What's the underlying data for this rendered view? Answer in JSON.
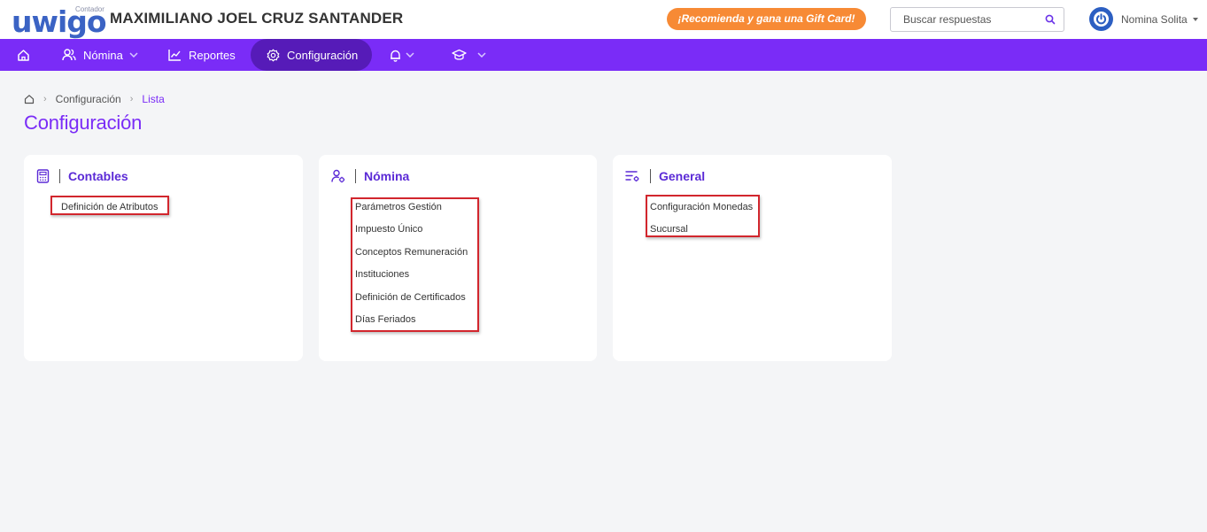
{
  "header": {
    "logo_text": "uwigo",
    "logo_sub": "Contador",
    "company_name": "MAXIMILIANO JOEL CRUZ SANTANDER",
    "promo_label": "¡Recomienda y gana una Gift Card!",
    "search_placeholder": "Buscar respuestas",
    "user_name": "Nomina Solita"
  },
  "nav": {
    "items": [
      {
        "label": "",
        "icon": "home-icon"
      },
      {
        "label": "Nómina",
        "icon": "users-icon",
        "dropdown": true
      },
      {
        "label": "Reportes",
        "icon": "chart-icon"
      },
      {
        "label": "Configuración",
        "icon": "gear-icon",
        "active": true
      },
      {
        "label": "",
        "icon": "bell-icon",
        "dropdown": true
      },
      {
        "label": "",
        "icon": "graduation-cap-icon",
        "dropdown": true
      }
    ]
  },
  "breadcrumb": {
    "items": [
      "Configuración",
      "Lista"
    ]
  },
  "page_title": "Configuración",
  "cards": [
    {
      "title": "Contables",
      "icon": "calculator-icon",
      "links": [
        "Definición de Atributos"
      ]
    },
    {
      "title": "Nómina",
      "icon": "user-gear-icon",
      "links": [
        "Parámetros Gestión",
        "Impuesto Único",
        "Conceptos Remuneración",
        "Instituciones",
        "Definición de Certificados",
        "Días Feriados"
      ]
    },
    {
      "title": "General",
      "icon": "list-settings-icon",
      "links": [
        "Configuración Monedas",
        "Sucursal"
      ]
    }
  ],
  "colors": {
    "accent": "#7a2cf7",
    "accent_dark": "#561bb8",
    "promo": "#f78a35",
    "highlight_box": "#d2262d"
  }
}
